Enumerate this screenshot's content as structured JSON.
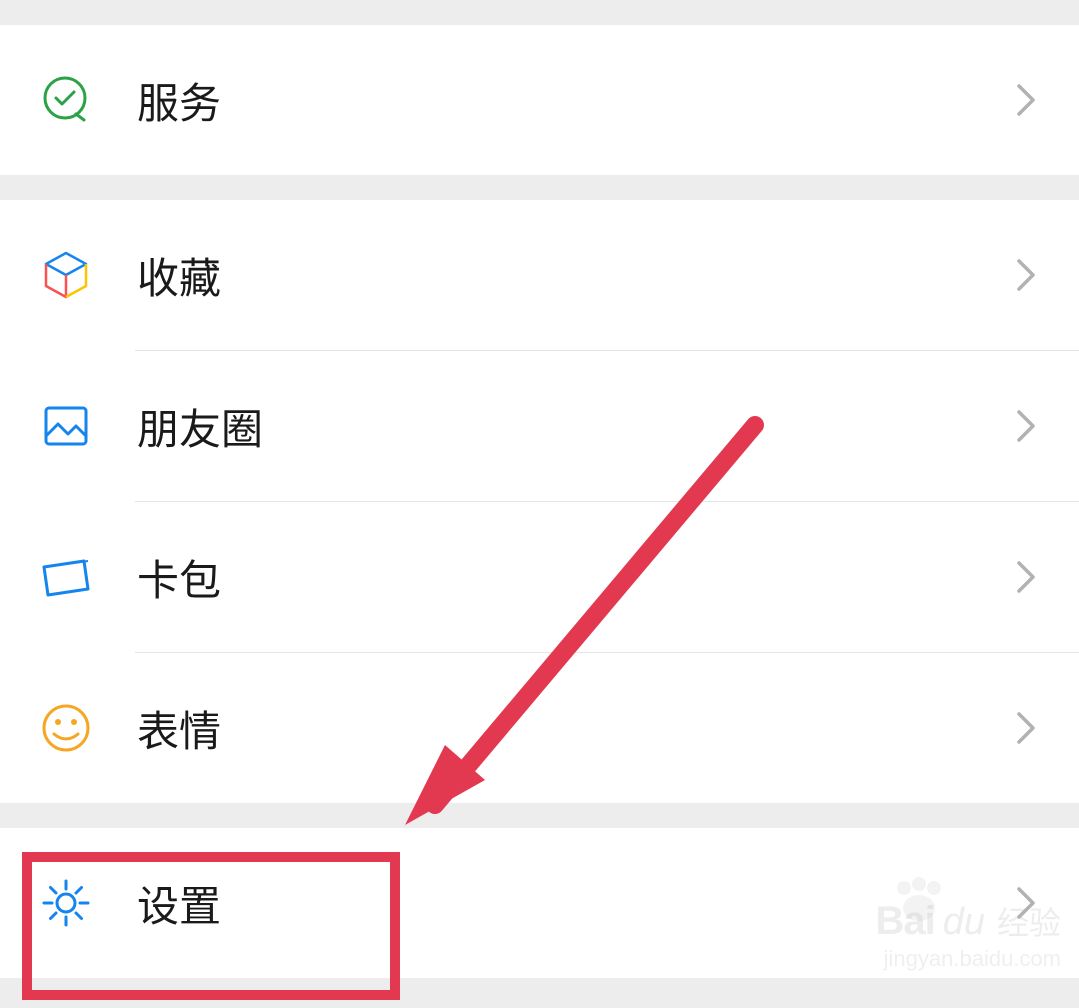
{
  "sections": [
    {
      "items": [
        {
          "id": "services",
          "label": "服务",
          "icon": "service-icon"
        }
      ]
    },
    {
      "items": [
        {
          "id": "favorites",
          "label": "收藏",
          "icon": "cube-icon"
        },
        {
          "id": "moments",
          "label": "朋友圈",
          "icon": "moments-icon"
        },
        {
          "id": "cards",
          "label": "卡包",
          "icon": "card-icon"
        },
        {
          "id": "stickers",
          "label": "表情",
          "icon": "emoji-icon"
        }
      ]
    },
    {
      "items": [
        {
          "id": "settings",
          "label": "设置",
          "icon": "gear-icon"
        }
      ]
    }
  ],
  "annotation": {
    "highlighted_item": "settings",
    "arrow_color": "#e33950"
  },
  "watermark": {
    "brand_part1": "Bai",
    "brand_part2": "du",
    "brand_suffix": "经验",
    "url": "jingyan.baidu.com"
  },
  "colors": {
    "service_green": "#2ba245",
    "cube_blue": "#1485ee",
    "cube_red": "#fa5151",
    "cube_yellow": "#ffc300",
    "moments_blue": "#1485ee",
    "card_blue": "#1485ee",
    "emoji_orange": "#f5a623",
    "gear_blue": "#1485ee",
    "chevron_gray": "#b2b2b2",
    "highlight_red": "#e33950"
  }
}
